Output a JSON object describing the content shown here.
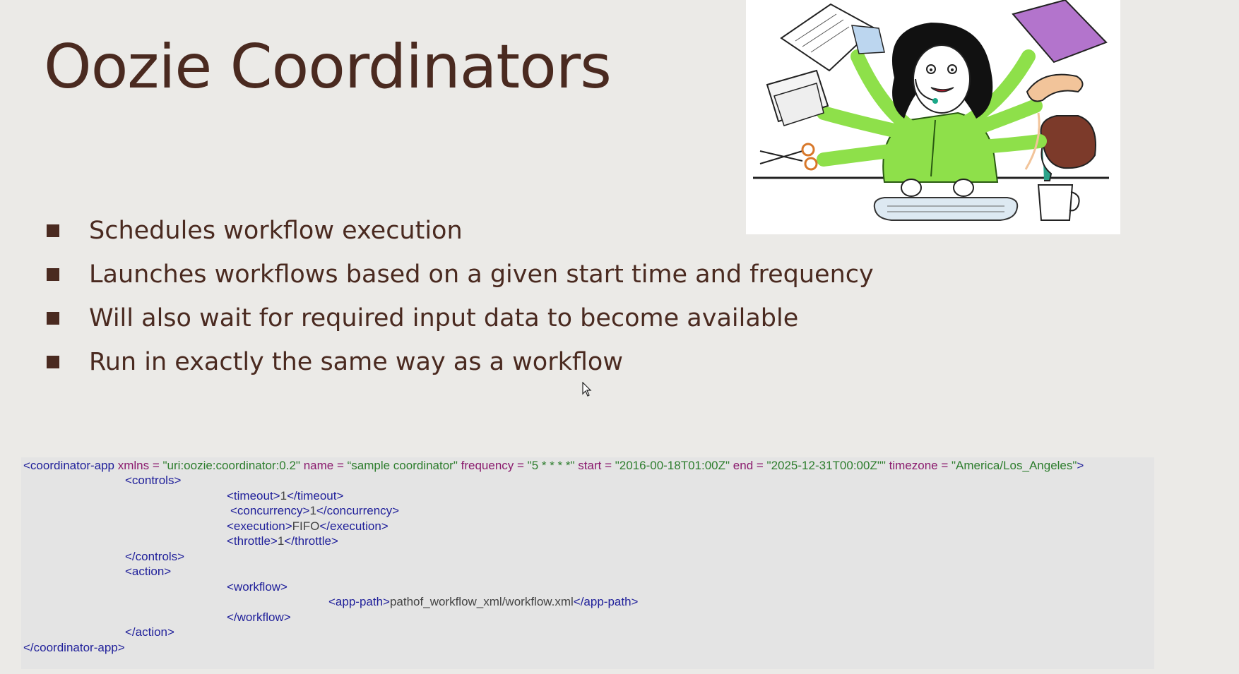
{
  "slide": {
    "title": "Oozie Coordinators",
    "bullets": [
      "Schedules workflow execution",
      "Launches workflows based on a given start time and frequency",
      "Will also wait for required input data to become available",
      "Run in exactly the same way as a workflow"
    ]
  },
  "code": {
    "root_open": "<coordinator-app",
    "attrs": [
      {
        "name": " xmlns",
        "eq": " = ",
        "value": "\"uri:oozie:coordinator:0.2\""
      },
      {
        "name": " name",
        "eq": " = ",
        "value": "“sample coordinator\""
      },
      {
        "name": " frequency",
        "eq": " = ",
        "value": "\"5 * * * *\""
      },
      {
        "name": " start",
        "eq": " = ",
        "value": "\"2016-00-18T01:00Z\""
      },
      {
        "name": " end",
        "eq": " = ",
        "value": "\"2025-12-31T00:00Z\"\""
      },
      {
        "name": " timezone",
        "eq": " = ",
        "value": "\"America/Los_Angeles\""
      }
    ],
    "root_open_end": ">",
    "controls_open": "<controls>",
    "timeout_open": "<timeout>",
    "timeout_value": "1",
    "timeout_close": "</timeout>",
    "concurrency_open": "<concurrency>",
    "concurrency_value": "1",
    "concurrency_close": "</concurrency>",
    "execution_open": "<execution>",
    "execution_value": "FIFO",
    "execution_close": "</execution>",
    "throttle_open": "<throttle>",
    "throttle_value": "1",
    "throttle_close": "</throttle>",
    "controls_close": "</controls>",
    "action_open": "<action>",
    "workflow_open": "<workflow>",
    "app_path_open": "<app-path>",
    "app_path_value": "pathof_workflow_xml/workflow.xml",
    "app_path_close": "</app-path>",
    "workflow_close": "</workflow>",
    "action_close": "</action>",
    "root_close": "</coordinator-app>"
  },
  "colors": {
    "title": "#4a2a20",
    "background": "#ebeae7",
    "code_tag": "#1f1f9a",
    "code_attr": "#8b1b6e",
    "code_value": "#2d7d2d"
  },
  "icons": {
    "illustration": "multitasking-woman-illustration",
    "cursor": "mouse-pointer-icon"
  }
}
